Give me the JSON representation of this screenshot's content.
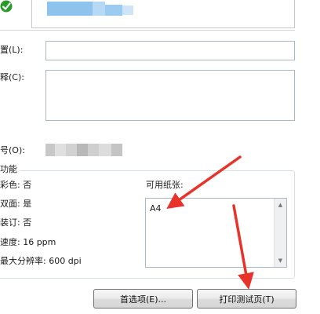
{
  "general": {
    "printer_name_value": "",
    "location_label": "置(L):",
    "location_value": "",
    "comment_label": "释(C):",
    "comment_value": "",
    "model_label": "号(O):",
    "model_value": ""
  },
  "features": {
    "group_title": "功能",
    "color": "彩色: 否",
    "duplex": "双面: 是",
    "staple": "装订: 否",
    "speed": "速度: 16 ppm",
    "max_resolution": "最大分辨率: 600 dpi",
    "paper_label": "可用纸张:",
    "paper_sizes": [
      "A4"
    ]
  },
  "buttons": {
    "preferences": "首选项(E)...",
    "print_test_page": "打印测试页(T)"
  },
  "colors": {
    "accent_arrow": "#e8332a",
    "border": "#a9b8c9",
    "group_border": "#d5dfe5"
  },
  "icons": {
    "status": "green-check-icon"
  }
}
